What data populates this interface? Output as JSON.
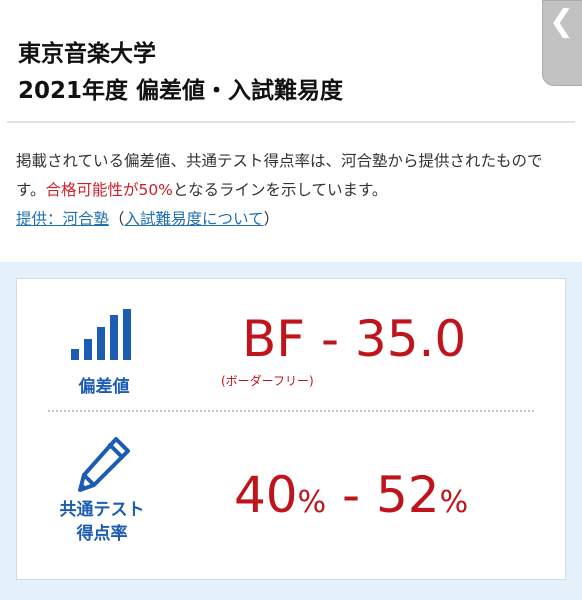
{
  "header": {
    "title_line1": "東京音楽大学",
    "title_line2": "2021年度 偏差値・入試難易度",
    "nav_glyph": "❮"
  },
  "description": {
    "text_before": "掲載されている偏差値、共通テスト得点率は、河合塾から提供されたものです。",
    "text_red": "合格可能性が50%",
    "text_after": "となるラインを示しています。",
    "link_provider": "提供：河合塾",
    "paren_open": "（",
    "link_about": "入試難易度について",
    "paren_close": "）"
  },
  "rows": {
    "hensachi": {
      "label": "偏差値",
      "value": "BF - 35.0",
      "note": "(ボーダーフリー)"
    },
    "test": {
      "label_line1": "共通テスト",
      "label_line2": "得点率",
      "value_low": "40",
      "value_high": "52",
      "unit": "%",
      "separator": " - "
    }
  },
  "colors": {
    "accent_blue": "#1c5db3",
    "value_red": "#c0141c",
    "panel_bg": "#e4f1fa"
  },
  "icons": {
    "hensachi_icon": "bar-chart-icon",
    "test_icon": "pencil-icon"
  }
}
